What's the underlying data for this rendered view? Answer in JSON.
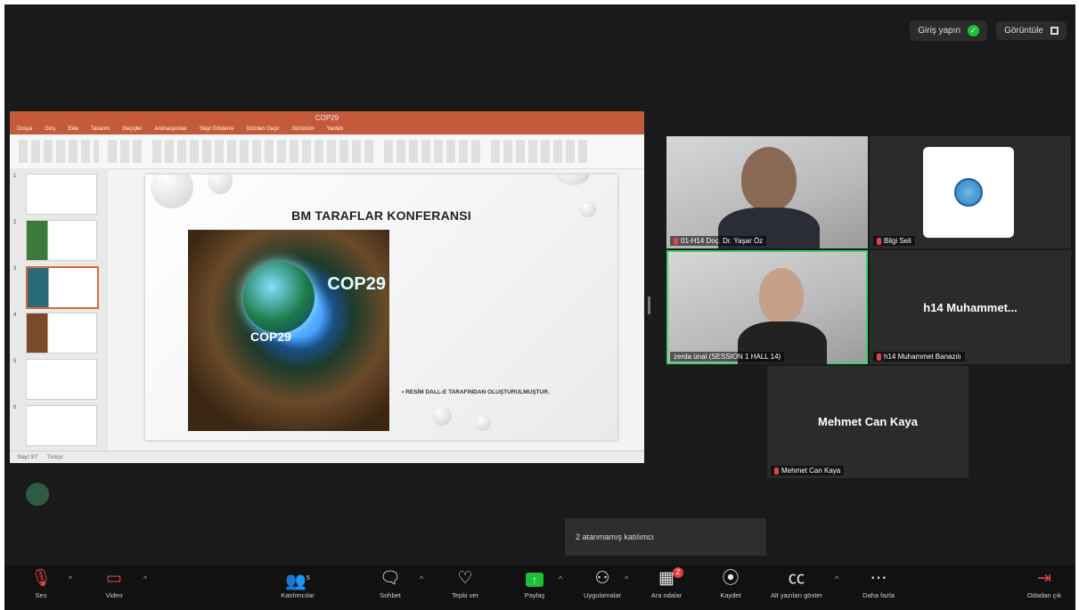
{
  "topbar": {
    "signin": "Giriş yapın",
    "view": "Görüntüle"
  },
  "presentation": {
    "window_title": "COP29",
    "ribbon_tabs": [
      "Dosya",
      "Giriş",
      "Ekle",
      "Tasarım",
      "Geçişler",
      "Animasyonlar",
      "Slayt Gösterisi",
      "Gözden Geçir",
      "Görünüm",
      "Yardım"
    ],
    "slide_numbers": [
      "1",
      "2",
      "3",
      "4",
      "5",
      "6"
    ],
    "slide_title": "BM TARAFLAR KONFERANSI",
    "image_text_1": "COP29",
    "image_text_2": "COP29",
    "caption": "• RESİM DALL-E TARAFINDAN OLUŞTURULMUŞTUR.",
    "status_left": "Slayt 3/7",
    "status_lang": "Türkçe"
  },
  "participants": [
    {
      "name": "01-H14 Doç. Dr. Yaşar Öz",
      "muted": true
    },
    {
      "name": "Bilgi Seli",
      "muted": true
    },
    {
      "name": "zerda ünal (SESSION 1 HALL 14)",
      "muted": false,
      "active": true
    },
    {
      "name": "h14 Muhammet Banazılı",
      "display": "h14  Muhammet...",
      "muted": true
    },
    {
      "name": "Mehmet Can Kaya",
      "display": "Mehmet Can Kaya",
      "muted": true
    }
  ],
  "toast": "2 atanmamış katılımcı",
  "toolbar": {
    "audio": "Ses",
    "video": "Video",
    "participants": "Katılımcılar",
    "participants_count": "5",
    "chat": "Sohbet",
    "react": "Tepki ver",
    "share": "Paylaş",
    "apps": "Uygulamalar",
    "breakout": "Ara odalar",
    "breakout_badge": "2",
    "record": "Kaydet",
    "captions": "Alt yazıları göster",
    "more": "Daha fazla",
    "leave": "Odadan çık"
  },
  "colors": {
    "accent_green": "#1fbf3a",
    "muted_red": "#e04444",
    "ppt_orange": "#c55a3a"
  }
}
